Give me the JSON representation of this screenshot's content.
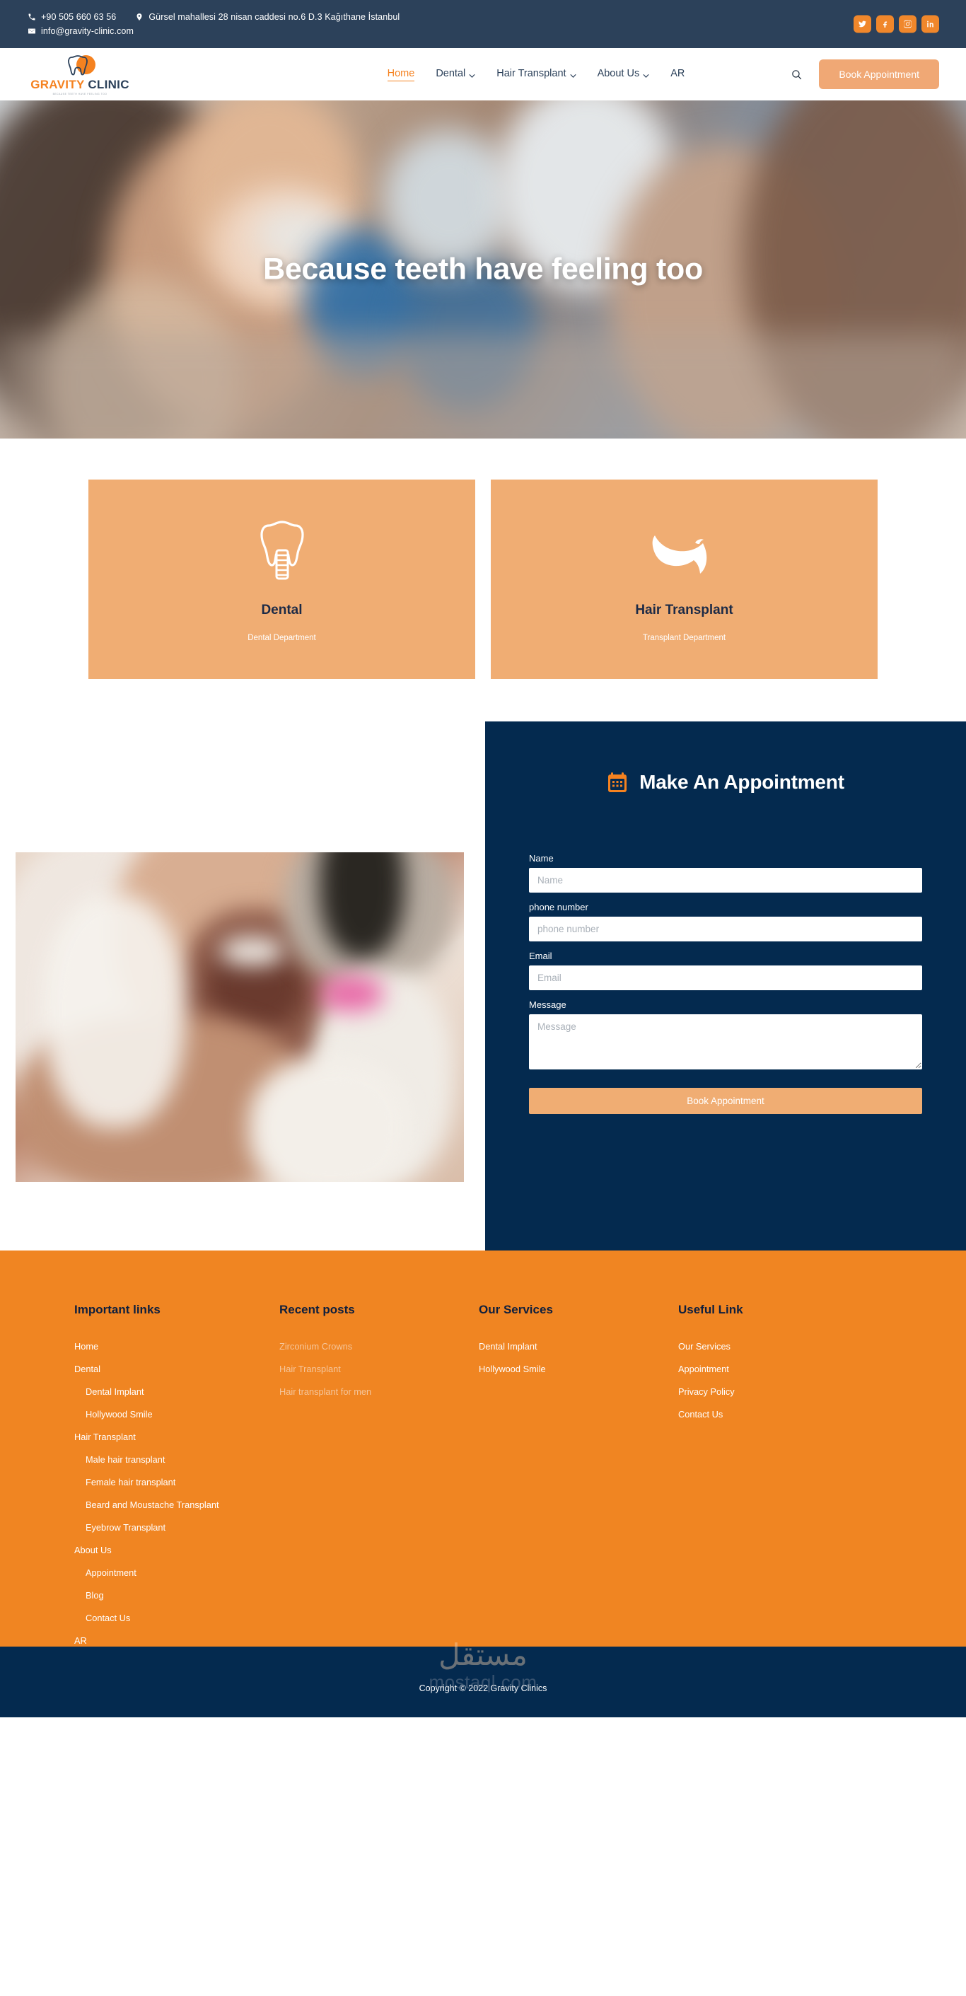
{
  "topbar": {
    "phone": "+90 505 660 63 56",
    "address": "Gürsel mahallesi 28 nisan caddesi no.6 D.3 Kağıthane İstanbul",
    "email": "info@gravity-clinic.com",
    "icons": {
      "phone": "phone-icon",
      "location": "location-pin-icon",
      "email": "envelope-icon"
    },
    "socials": [
      {
        "name": "twitter",
        "label": "Twitter"
      },
      {
        "name": "facebook",
        "label": "Facebook"
      },
      {
        "name": "instagram",
        "label": "Instagram"
      },
      {
        "name": "linkedin",
        "label": "LinkedIn"
      }
    ]
  },
  "brand": {
    "name_part1": "GRAVITY",
    "name_part2": " CLINIC",
    "tagline": "BECAUSE TEETH HAVE FEELING TOO"
  },
  "nav": {
    "items": [
      {
        "label": "Home",
        "active": true,
        "caret": false
      },
      {
        "label": "Dental",
        "active": false,
        "caret": true
      },
      {
        "label": "Hair Transplant",
        "active": false,
        "caret": true
      },
      {
        "label": "About Us",
        "active": false,
        "caret": true
      },
      {
        "label": "AR",
        "active": false,
        "caret": false
      }
    ],
    "search_icon": "search-icon",
    "book_label": "Book Appointment"
  },
  "hero": {
    "title": "Because teeth have feeling too"
  },
  "cards": [
    {
      "title": "Dental",
      "subtitle": "Dental Department",
      "icon": "tooth-implant-icon"
    },
    {
      "title": "Hair Transplant",
      "subtitle": "Transplant Department",
      "icon": "hair-quiff-icon"
    }
  ],
  "appointment": {
    "title": "Make An Appointment",
    "icon": "calendar-icon",
    "fields": [
      {
        "label": "Name",
        "placeholder": "Name",
        "value": "",
        "type": "text"
      },
      {
        "label": "phone number",
        "placeholder": "phone number",
        "value": "",
        "type": "text"
      },
      {
        "label": "Email",
        "placeholder": "Email",
        "value": "",
        "type": "text"
      },
      {
        "label": "Message",
        "placeholder": "Message",
        "value": "",
        "type": "textarea"
      }
    ],
    "submit_label": "Book Appointment"
  },
  "footer": {
    "columns": [
      {
        "title": "Important links",
        "links": [
          {
            "label": "Home",
            "sub": false,
            "muted": false
          },
          {
            "label": "Dental",
            "sub": false,
            "muted": false
          },
          {
            "label": "Dental Implant",
            "sub": true,
            "muted": false
          },
          {
            "label": "Hollywood Smile",
            "sub": true,
            "muted": false
          },
          {
            "label": "Hair Transplant",
            "sub": false,
            "muted": false
          },
          {
            "label": "Male hair transplant",
            "sub": true,
            "muted": false
          },
          {
            "label": "Female hair transplant",
            "sub": true,
            "muted": false
          },
          {
            "label": "Beard and Moustache Transplant",
            "sub": true,
            "muted": false
          },
          {
            "label": "Eyebrow Transplant",
            "sub": true,
            "muted": false
          },
          {
            "label": "About Us",
            "sub": false,
            "muted": false
          },
          {
            "label": "Appointment",
            "sub": true,
            "muted": false
          },
          {
            "label": "Blog",
            "sub": true,
            "muted": false
          },
          {
            "label": "Contact Us",
            "sub": true,
            "muted": false
          },
          {
            "label": "AR",
            "sub": false,
            "muted": false
          }
        ]
      },
      {
        "title": "Recent posts",
        "links": [
          {
            "label": "Zirconium Crowns",
            "sub": false,
            "muted": true
          },
          {
            "label": "Hair Transplant",
            "sub": false,
            "muted": true
          },
          {
            "label": "Hair transplant for men",
            "sub": false,
            "muted": true
          }
        ]
      },
      {
        "title": "Our Services",
        "links": [
          {
            "label": "Dental Implant",
            "sub": false,
            "muted": false
          },
          {
            "label": "Hollywood Smile",
            "sub": false,
            "muted": false
          }
        ]
      },
      {
        "title": "Useful Link",
        "links": [
          {
            "label": "Our Services",
            "sub": false,
            "muted": false
          },
          {
            "label": "Appointment",
            "sub": false,
            "muted": false
          },
          {
            "label": "Privacy Policy",
            "sub": false,
            "muted": false
          },
          {
            "label": "Contact Us",
            "sub": false,
            "muted": false
          }
        ]
      }
    ],
    "watermark_ar": "مستقل",
    "watermark_en": "mostaql.com",
    "copyright": "Copyright © 2022 Gravity Clinics"
  },
  "colors": {
    "navy_dark": "#2c415a",
    "navy_panel": "#042a4f",
    "orange": "#f08522",
    "orange_light": "#f0ad73",
    "orange_logo": "#f58220"
  }
}
